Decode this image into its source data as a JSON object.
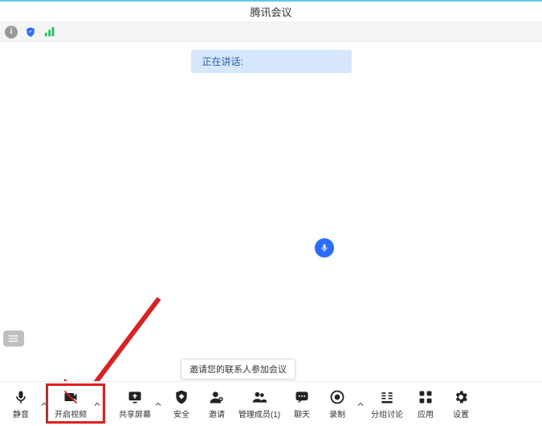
{
  "title": "腾讯会议",
  "speaking_label": "正在讲话:",
  "tooltip_invite": "邀请您的联系人参加会议",
  "toolbar": {
    "mute": "静音",
    "video": "开启视频",
    "share": "共享屏幕",
    "security": "安全",
    "invite": "邀请",
    "members": "管理成员(1)",
    "chat": "聊天",
    "record": "录制",
    "breakout": "分组讨论",
    "apps": "应用",
    "settings": "设置"
  },
  "colors": {
    "accent": "#2b6dff",
    "highlight": "#e02020",
    "banner_bg": "#d6e6fb"
  }
}
